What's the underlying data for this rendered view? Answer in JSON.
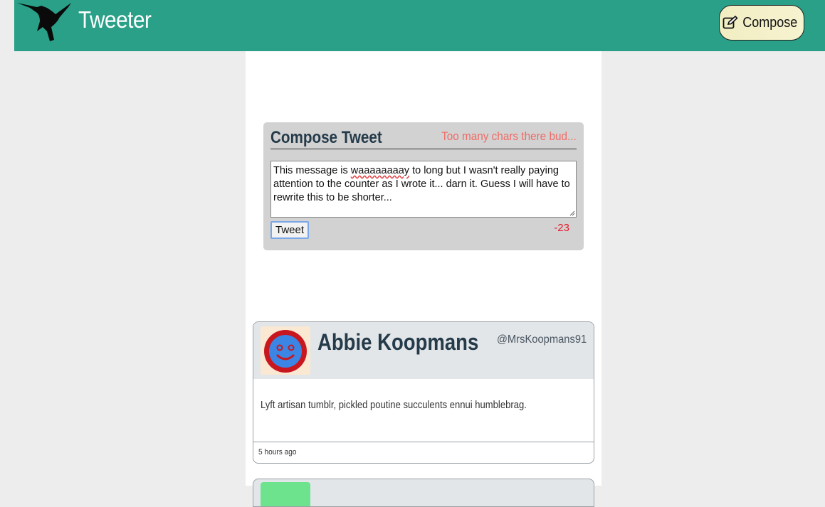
{
  "nav": {
    "brand": "Tweeter",
    "compose_label": "Compose",
    "logo_icon": "hummingbird-icon",
    "compose_icon": "edit-icon",
    "bg_color": "#2aa088"
  },
  "compose": {
    "title": "Compose Tweet",
    "error": "Too many chars there bud...",
    "text_before": "This message is ",
    "text_misspelled": "waaaaaaaay",
    "text_after": " to long but I wasn't really paying attention to the counter as I wrote it... darn it. Guess I will have to rewrite this to be shorter...",
    "submit_label": "Tweet",
    "counter": "-23"
  },
  "tweets": [
    {
      "name": "Abbie Koopmans",
      "handle": "@MrsKoopmans91",
      "content": "Lyft artisan tumblr, pickled poutine succulents ennui humblebrag.",
      "time": "5 hours ago",
      "avatar_icon": "smiley-avatar-icon"
    }
  ]
}
